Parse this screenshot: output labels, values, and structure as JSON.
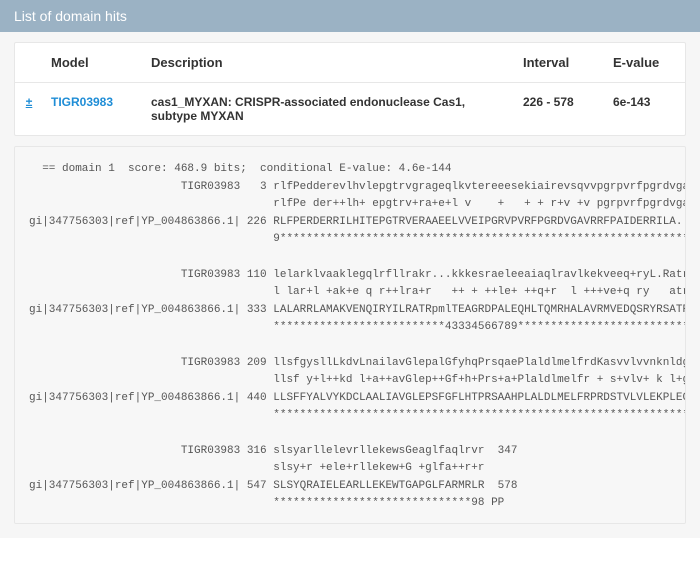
{
  "header": {
    "title": "List of domain hits"
  },
  "table": {
    "columns": {
      "model": "Model",
      "description": "Description",
      "interval": "Interval",
      "evalue": "E-value"
    },
    "rows": [
      {
        "toggle": "±",
        "model": "TIGR03983",
        "description": "cas1_MYXAN: CRISPR-associated endonuclease Cas1, subtype MYXAN",
        "interval": "226 - 578",
        "evalue": "6e-143"
      }
    ]
  },
  "alignment": {
    "text": "  == domain 1  score: 468.9 bits;  conditional E-value: 4.6e-144\n                       TIGR03983   3 rlfPedderevlhvlepgtrvgrageqlkvtereeesekiairevsqvvpgrpvrfpgrdvgavlq\n                                     rlfPe der++lh+ epgtrv+ra+e+l v    +   + + r+v +v pgrpvrfpgrdvgav +\ngi|347756303|ref|YP_004863866.1| 226 RLFPERDERRILHITEPGTRVERAAEELVVEIPGRVPVRFPGRDVGAVRRFPAIDERRILA....\n                                     9*****************************************************************\n\n                       TIGR03983 110 lelarklvaaklegqlrfllrakr...kkkesraeleeaiaqlravlkekveeq+ryL.Ratrpml\n                                     l lar+l +ak+e q r++lra+r   ++ + ++le+ ++q+r  l +++ve+q ry   atrpml\ngi|347756303|ref|YP_004863866.1| 333 LALARRLAMAKVENQIRYILRATRpmlTEAGRDPALEQHLTQMRHALAVRMVEDQSRYRSATRPML\n                                     **************************43334566789*****************************\n\n                       TIGR03983 209 llsfgysllLkdvLnailavGlepalGfyhqPrsqaePlaldlmelfrdKasvvlvvnknldg...\n                                     llsf y+l++kd l+a++avGlep++Gf+h+Prs+a+Plaldlmelfr + s+vlv+ k l+g   \ngi|347756303|ref|YP_004863866.1| 440 LLSFFYALVYKDCLAALIAVGLEPSFGFLHTPRSAAHPLALDLMELFRPRDSTVLVLEKPLEGrrs\n                                     ******************************************************************\n\n                       TIGR03983 316 slsyarllelevrllekewsGeaglfaqlrvr  347\n                                     slsy+r +ele+rllekew+G +glfa++r+r\ngi|347756303|ref|YP_004863866.1| 547 SLSYQRAIELEARLLEKEWTGAPGLFARMRLR  578\n                                     ******************************98 PP\n"
  }
}
